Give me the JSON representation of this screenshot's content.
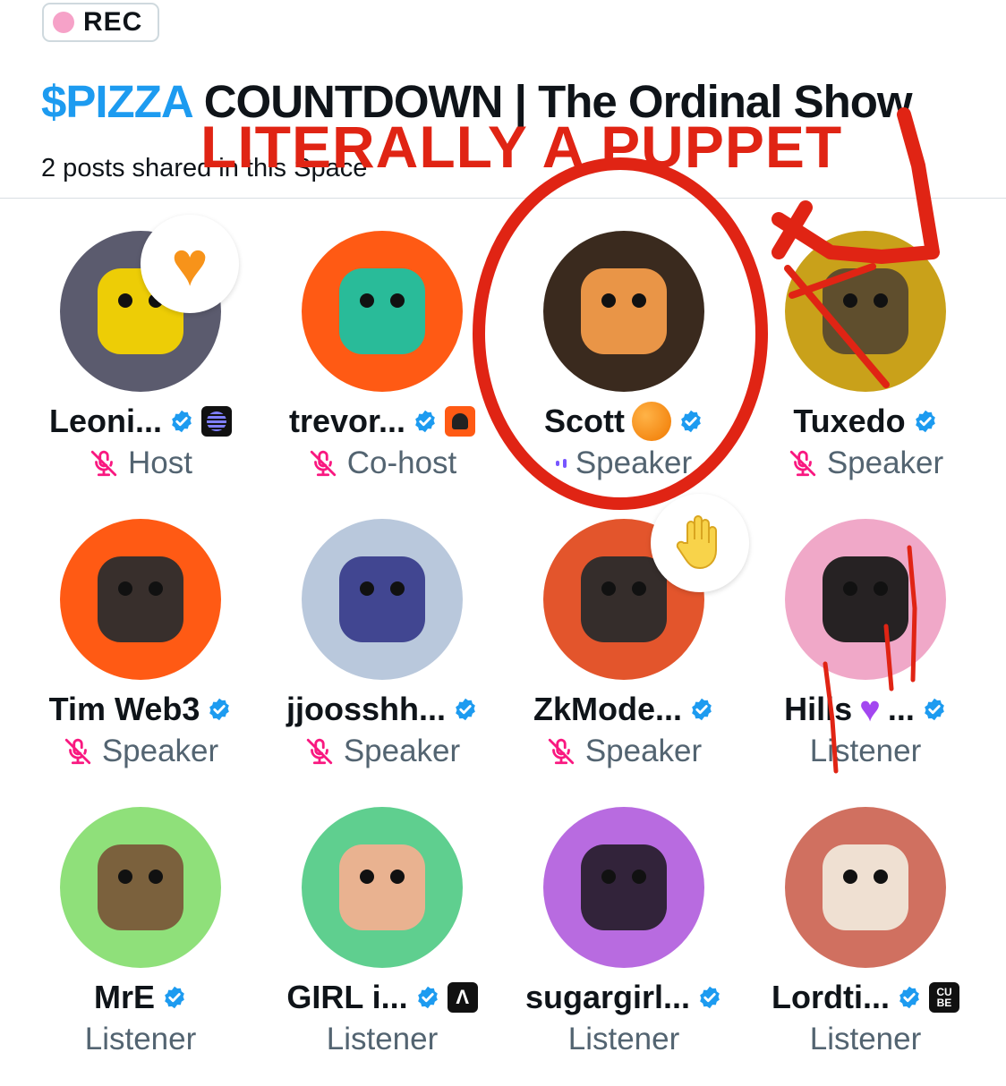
{
  "rec_badge": {
    "label": "REC",
    "dot_color": "#f6a2c8"
  },
  "space": {
    "title_ticker": "$PIZZA",
    "title_rest": "COUNTDOWN | The Ordinal Show",
    "ticker_color": "#1d9bf0",
    "subtitle": "2 posts shared in this Space"
  },
  "annotation": {
    "text": "LITERALLY A PUPPET",
    "color": "#e02414"
  },
  "participants": [
    {
      "name": "Leoni...",
      "role": "Host",
      "verified": true,
      "status": "muted",
      "badge": "stripes-badge",
      "reaction": "heart-reaction",
      "avatar_bg": "#5b5b6e",
      "face": "#f5d400"
    },
    {
      "name": "trevor...",
      "role": "Co-host",
      "verified": true,
      "status": "muted",
      "badge": "ninja-badge",
      "reaction": null,
      "avatar_bg": "#ff5a14",
      "face": "#1ec1a0"
    },
    {
      "name": "Scott",
      "role": "Speaker",
      "verified": true,
      "status": "speaking",
      "emoji": "orange-circle-emoji",
      "avatar_bg": "#3a2a1e",
      "face": "#f29b4a"
    },
    {
      "name": "Tuxedo",
      "role": "Speaker",
      "verified": true,
      "status": "muted",
      "avatar_bg": "#c9a11a",
      "face": "#5a4a2e"
    },
    {
      "name": "Tim Web3",
      "role": "Speaker",
      "verified": true,
      "status": "muted",
      "avatar_bg": "#ff5a14",
      "face": "#2d2d2d"
    },
    {
      "name": "jjoosshh...",
      "role": "Speaker",
      "verified": true,
      "status": "muted",
      "avatar_bg": "#b9c8dc",
      "face": "#3a3f8c"
    },
    {
      "name": "ZkMode...",
      "role": "Speaker",
      "verified": true,
      "status": "muted",
      "reaction": "raised-hand-reaction",
      "avatar_bg": "#e3552c",
      "face": "#2b2b2b"
    },
    {
      "name": "Hills",
      "name_suffix": "...",
      "role": "Listener",
      "verified": true,
      "emoji": "purple-heart-emoji",
      "avatar_bg": "#f0a8c8",
      "face": "#1a1a1a"
    },
    {
      "name": "MrE",
      "role": "Listener",
      "verified": true,
      "avatar_bg": "#8fe07a",
      "face": "#7a5a3a"
    },
    {
      "name": "GIRL i...",
      "role": "Listener",
      "verified": true,
      "badge": "a-badge",
      "avatar_bg": "#5fcf8f",
      "face": "#f0b090"
    },
    {
      "name": "sugargirl...",
      "role": "Listener",
      "verified": true,
      "avatar_bg": "#b86be0",
      "face": "#2a2030"
    },
    {
      "name": "Lordti...",
      "role": "Listener",
      "verified": true,
      "badge": "cube-badge",
      "badge_text": "CU BE",
      "avatar_bg": "#d07060",
      "face": "#f0e6d8"
    }
  ],
  "colors": {
    "muted_mic": "#f91880",
    "verified": "#1d9bf0",
    "speaking_bars": "#7856ff"
  }
}
